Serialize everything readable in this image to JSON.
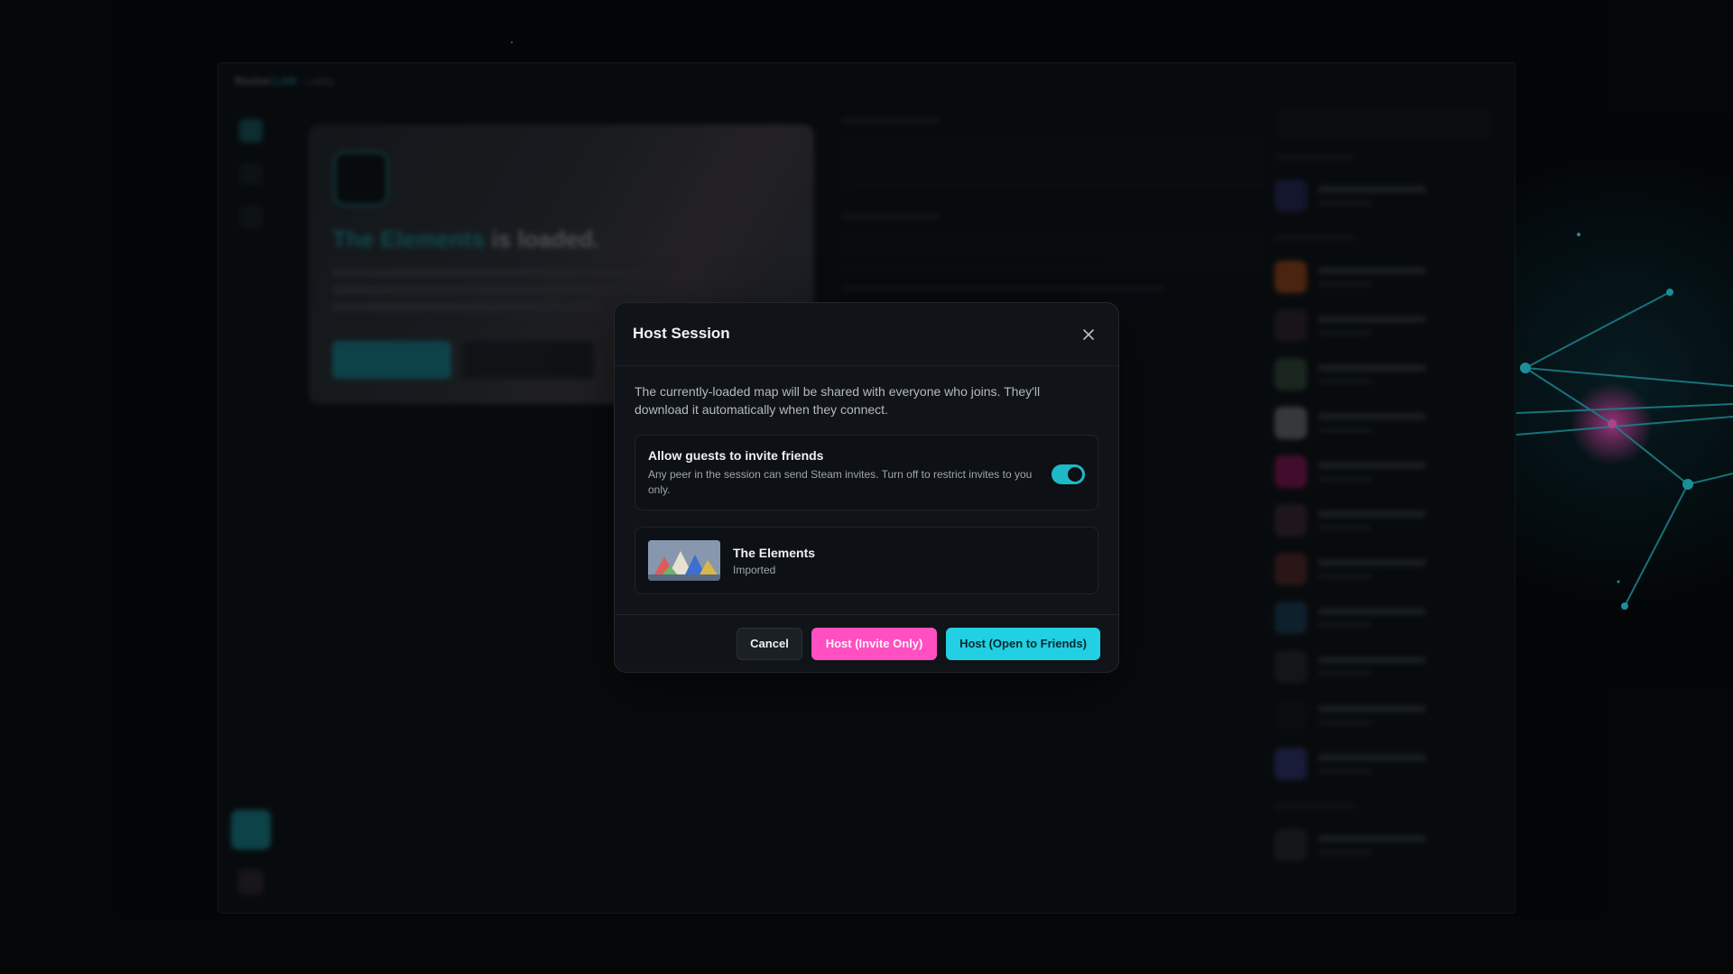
{
  "app": {
    "brand_prefix": "Rocket",
    "brand_suffix": "LAN",
    "section": "Lobby"
  },
  "hero": {
    "map_name": "The Elements",
    "title_suffix": "is loaded."
  },
  "modal": {
    "title": "Host Session",
    "description": "The currently-loaded map will be shared with everyone who joins. They'll download it automatically when they connect.",
    "option": {
      "title": "Allow guests to invite friends",
      "description": "Any peer in the session can send Steam invites. Turn off to restrict invites to you only.",
      "enabled": true
    },
    "map": {
      "name": "The Elements",
      "status": "Imported"
    },
    "buttons": {
      "cancel": "Cancel",
      "host_invite": "Host (Invite Only)",
      "host_open": "Host (Open to Friends)"
    }
  },
  "icons": {
    "close": "close-icon",
    "toggle": "toggle-switch"
  },
  "colors": {
    "accent_cyan": "#22cfe3",
    "accent_pink": "#ff4fc1",
    "modal_bg": "#101317",
    "page_bg": "#040608"
  }
}
